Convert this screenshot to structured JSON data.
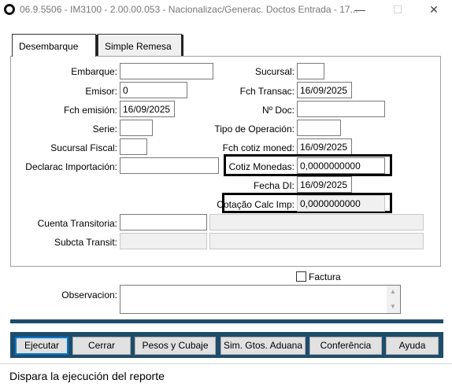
{
  "window": {
    "title": "06.9.5506 - IM3100 - 2.00.00.053 - Nacionalizac/Generac. Doctos Entrada - 17...",
    "minimize": "—",
    "maximize": "☐",
    "close": "✕"
  },
  "tabs": [
    {
      "label": "Desembarque"
    },
    {
      "label": "Simple Remesa"
    }
  ],
  "form": {
    "embarque": {
      "label": "Embarque:",
      "value": ""
    },
    "emisor": {
      "label": "Emisor:",
      "value": "0"
    },
    "fch_emision": {
      "label": "Fch emisión:",
      "value": "16/09/2025"
    },
    "serie": {
      "label": "Serie:",
      "value": ""
    },
    "sucursal_fiscal": {
      "label": "Sucursal Fiscal:",
      "value": ""
    },
    "declarac_importacion": {
      "label": "Declarac Importación:",
      "value": ""
    },
    "sucursal": {
      "label": "Sucursal:",
      "value": ""
    },
    "fch_transac": {
      "label": "Fch Transac:",
      "value": "16/09/2025"
    },
    "nro_doc": {
      "label": "Nº Doc:",
      "value": ""
    },
    "tipo_operacion": {
      "label": "Tipo de Operación:",
      "value": ""
    },
    "fch_cotiz_moned": {
      "label": "Fch cotiz moned:",
      "value": "16/09/2025"
    },
    "cotiz_monedas": {
      "label": "Cotiz Monedas:",
      "value": "0,0000000000"
    },
    "fecha_di": {
      "label": "Fecha DI:",
      "value": "16/09/2025"
    },
    "cotacao_calc_imp": {
      "label": "Cotação Calc Imp:",
      "value": "0,0000000000"
    },
    "cuenta_transitoria": {
      "label": "Cuenta Transitoria:",
      "value": "",
      "desc": ""
    },
    "subcta_transit": {
      "label": "Subcta Transit:",
      "value": "",
      "desc": ""
    },
    "factura": {
      "label": "Factura",
      "checked": false
    },
    "observacion": {
      "label": "Observacion:",
      "value": ""
    }
  },
  "buttons": [
    {
      "label": "Ejecutar"
    },
    {
      "label": "Cerrar"
    },
    {
      "label": "Pesos y Cubaje"
    },
    {
      "label": "Sim. Gtos. Aduana"
    },
    {
      "label": "Conferência"
    },
    {
      "label": "Ayuda"
    }
  ],
  "status": "Dispara la ejecución del reporte",
  "colors": {
    "accent": "#1e4d6b",
    "default_button_border": "#0078d7"
  }
}
